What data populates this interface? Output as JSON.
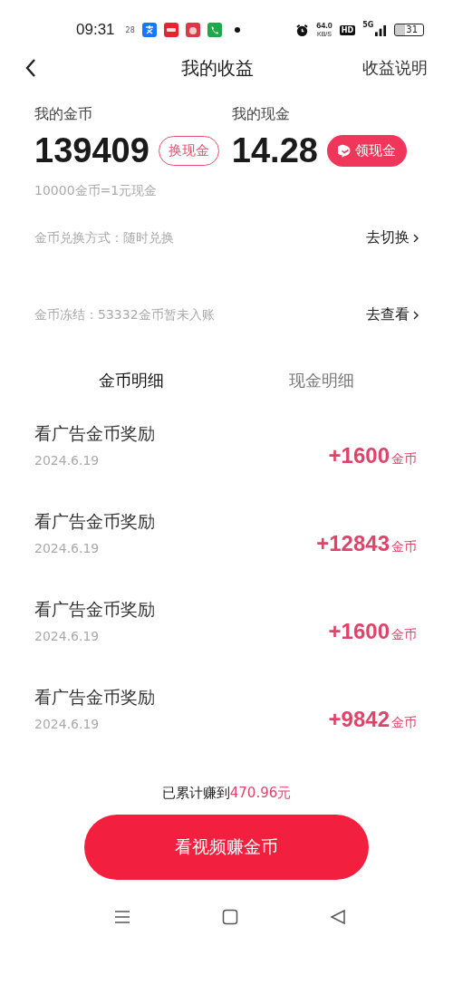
{
  "status_bar": {
    "time": "09:31",
    "date_badge": "28",
    "network_speed": "64.0",
    "speed_unit": "KB/S",
    "hd": "HD",
    "network": "5G",
    "battery": "31"
  },
  "header": {
    "title": "我的收益",
    "action": "收益说明"
  },
  "balances": [
    {
      "label": "我的金币",
      "value": "139409",
      "button": "换现金",
      "kind": "outline"
    },
    {
      "label": "我的现金",
      "value": "14.28",
      "button": "领现金",
      "kind": "filled"
    }
  ],
  "rate": "10000金币=1元现金",
  "info_rows": [
    {
      "text": "金币兑换方式：随时兑换",
      "link": "去切换"
    },
    {
      "text": "金币冻结：53332金币暂未入账",
      "link": "去查看"
    }
  ],
  "tabs": [
    {
      "label": "金币明细",
      "selected": true
    },
    {
      "label": "现金明细",
      "selected": false
    }
  ],
  "records": [
    {
      "title": "看广告金币奖励",
      "date": "2024.6.19",
      "amount": "+1600",
      "unit": "金币"
    },
    {
      "title": "看广告金币奖励",
      "date": "2024.6.19",
      "amount": "+12843",
      "unit": "金币"
    },
    {
      "title": "看广告金币奖励",
      "date": "2024.6.19",
      "amount": "+1600",
      "unit": "金币"
    },
    {
      "title": "看广告金币奖励",
      "date": "2024.6.19",
      "amount": "+9842",
      "unit": "金币"
    }
  ],
  "total": {
    "prefix": "已累计赚到",
    "amount": "470.96元"
  },
  "cta": "看视频赚金币"
}
